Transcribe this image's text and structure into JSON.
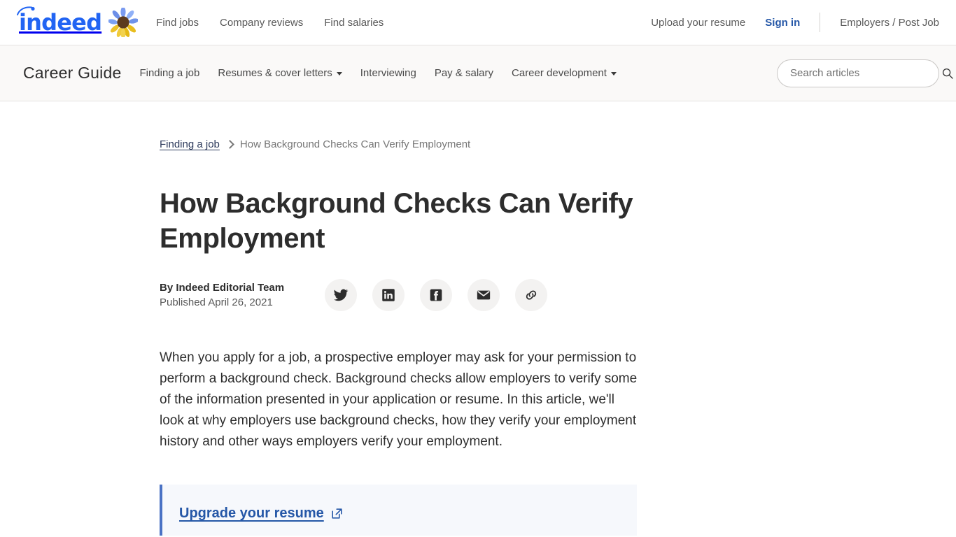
{
  "header": {
    "logo": {
      "brand": "indeed",
      "icon": "sunflower-icon",
      "brand_color": "#2164f3"
    },
    "nav": [
      {
        "label": "Find jobs",
        "name": "find-jobs"
      },
      {
        "label": "Company reviews",
        "name": "company-reviews"
      },
      {
        "label": "Find salaries",
        "name": "find-salaries"
      }
    ],
    "right": {
      "upload_resume": "Upload your resume",
      "sign_in": "Sign in",
      "sign_in_color": "#2557a7",
      "employers": "Employers / Post Job"
    }
  },
  "guidebar": {
    "title": "Career Guide",
    "items": [
      {
        "label": "Finding a job",
        "has_dropdown": false
      },
      {
        "label": "Resumes & cover letters",
        "has_dropdown": true
      },
      {
        "label": "Interviewing",
        "has_dropdown": false
      },
      {
        "label": "Pay & salary",
        "has_dropdown": false
      },
      {
        "label": "Career development",
        "has_dropdown": true
      }
    ],
    "search": {
      "placeholder": "Search articles",
      "value": "",
      "icon": "search-icon"
    }
  },
  "article": {
    "breadcrumb": {
      "parent": "Finding a job",
      "separator": "chevron-right-icon",
      "current": "How Background Checks Can Verify Employment"
    },
    "title": "How Background Checks Can Verify Employment",
    "author": "By Indeed Editorial Team",
    "published": "Published April 26, 2021",
    "share": [
      {
        "name": "share-twitter-button",
        "icon": "twitter-icon"
      },
      {
        "name": "share-linkedin-button",
        "icon": "linkedin-icon"
      },
      {
        "name": "share-facebook-button",
        "icon": "facebook-icon"
      },
      {
        "name": "share-email-button",
        "icon": "email-icon"
      },
      {
        "name": "share-link-button",
        "icon": "link-icon"
      }
    ],
    "intro": "When you apply for a job, a prospective employer may ask for your permission to perform a background check. Background checks allow employers to verify some of the information presented in your application or resume. In this article, we'll look at why employers use background checks, how they verify your employment history and other ways employers verify your employment.",
    "callout": {
      "link_label": "Upgrade your resume",
      "icon": "external-link-icon",
      "accent_color": "#4a72c4",
      "background_color": "#f6f8fc"
    }
  }
}
